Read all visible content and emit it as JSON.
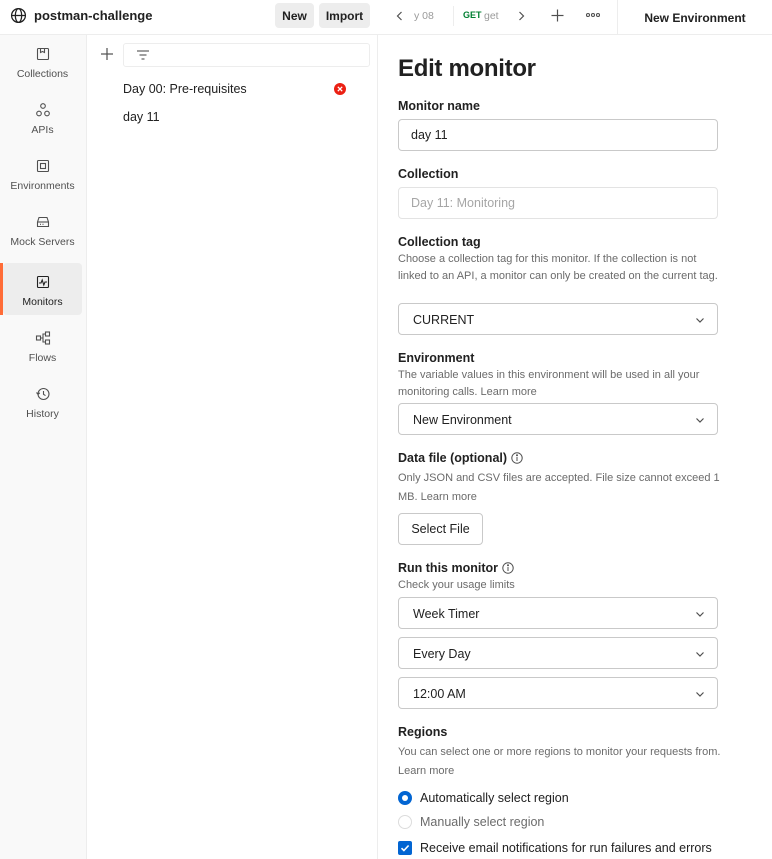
{
  "workspace": {
    "name": "postman-challenge",
    "new_label": "New",
    "import_label": "Import"
  },
  "sidebar": {
    "items": [
      {
        "label": "Collections",
        "icon": "collections-icon",
        "active": false
      },
      {
        "label": "APIs",
        "icon": "apis-icon",
        "active": false
      },
      {
        "label": "Environments",
        "icon": "environments-icon",
        "active": false
      },
      {
        "label": "Mock Servers",
        "icon": "mock-servers-icon",
        "active": false
      },
      {
        "label": "Monitors",
        "icon": "monitors-icon",
        "active": true
      },
      {
        "label": "Flows",
        "icon": "flows-icon",
        "active": false
      },
      {
        "label": "History",
        "icon": "history-icon",
        "active": false
      }
    ]
  },
  "monitor_list": {
    "items": [
      {
        "label": "Day 00: Pre-requisites",
        "status": "error"
      },
      {
        "label": "day 11",
        "status": ""
      }
    ]
  },
  "tabs": {
    "fragment_1": "y 08",
    "request_method": "GET",
    "fragment_2": "get",
    "active_tab": "New Environment"
  },
  "form": {
    "title": "Edit monitor",
    "monitor_name": {
      "label": "Monitor name",
      "value": "day 11"
    },
    "collection": {
      "label": "Collection",
      "value": "Day 11: Monitoring"
    },
    "collection_tag": {
      "label": "Collection tag",
      "description": "Choose a collection tag for this monitor. If the collection is not linked to an API, a monitor can only be created on the current tag.",
      "value": "CURRENT"
    },
    "environment": {
      "label": "Environment",
      "description": "The variable values in this environment will be used in all your monitoring calls.",
      "link": "Learn more",
      "value": "New Environment"
    },
    "data_file": {
      "label": "Data file (optional)",
      "description": "Only JSON and CSV files are accepted. File size cannot exceed 1 MB.",
      "link": "Learn more",
      "button": "Select File"
    },
    "run": {
      "label": "Run this monitor",
      "description": "Check your usage limits",
      "timer": "Week Timer",
      "frequency": "Every Day",
      "time": "12:00 AM"
    },
    "regions": {
      "label": "Regions",
      "description": "You can select one or more regions to monitor your requests from.",
      "link": "Learn more",
      "auto_label": "Automatically select region",
      "manual_label": "Manually select region"
    },
    "email_notifications_label": "Receive email notifications for run failures and errors"
  },
  "colors": {
    "accent": "#ff6c37",
    "primary": "#0265d2",
    "error": "#eb2013",
    "get_method": "#007f31"
  }
}
